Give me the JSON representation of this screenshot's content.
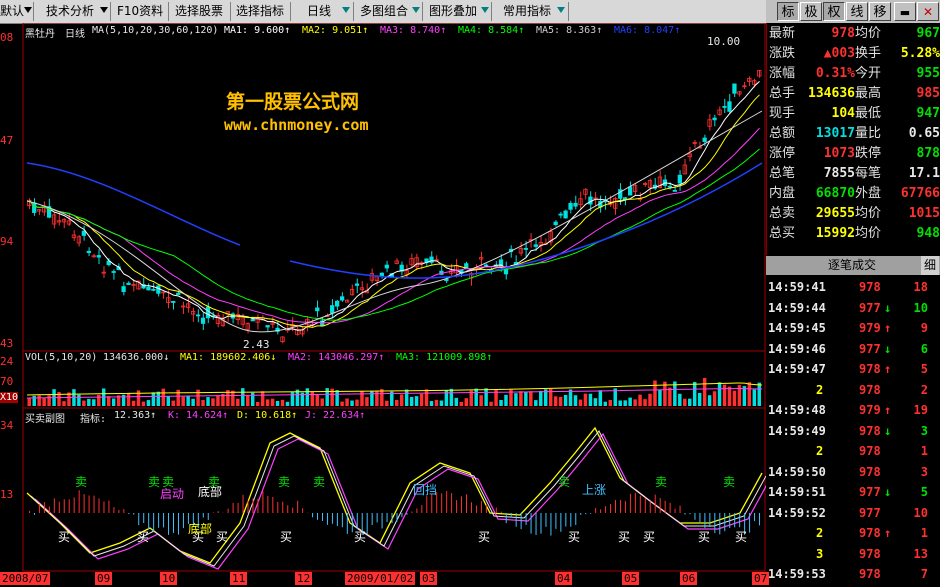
{
  "toolbar": {
    "items": [
      "默认",
      "技术分析",
      "F10资料",
      "选择股票",
      "选择指标",
      "日线",
      "多图组合",
      "图形叠加",
      "常用指标"
    ]
  },
  "right_tabs": [
    "标",
    "极",
    "权",
    "线",
    "移"
  ],
  "chart": {
    "stock_name": "黑牡丹",
    "period": "日线",
    "ma_header": "MA(5,10,20,30,60,120)",
    "ma": [
      {
        "label": "MA1:",
        "value": "9.600↑",
        "color": "#ffffff"
      },
      {
        "label": "MA2:",
        "value": "9.051↑",
        "color": "#ffff00"
      },
      {
        "label": "MA3:",
        "value": "8.740↑",
        "color": "#ff40ff"
      },
      {
        "label": "MA4:",
        "value": "8.584↑",
        "color": "#00ff00"
      },
      {
        "label": "MA5:",
        "value": "8.363↑",
        "color": "#cccccc"
      },
      {
        "label": "MA6:",
        "value": "8.047↑",
        "color": "#2040ff"
      }
    ],
    "watermark_title": "第一股票公式网",
    "watermark_url": "www.chnmoney.com",
    "high_label": "10.00",
    "low_label": "2.43",
    "y_labels": [
      "08",
      "47",
      "94",
      "43"
    ],
    "vol_header": "VOL(5,10,20)",
    "vol_value": "134636.000↓",
    "vol_ma": [
      {
        "label": "MA1:",
        "value": "189602.406↓",
        "color": "#ffff00"
      },
      {
        "label": "MA2:",
        "value": "143046.297↑",
        "color": "#ff40ff"
      },
      {
        "label": "MA3:",
        "value": "121009.898↑",
        "color": "#00ff00"
      }
    ],
    "vol_y_labels": [
      "24",
      "70",
      "X10"
    ],
    "ind_name": "买卖副图",
    "ind_label": "指标:",
    "ind_value": "12.363↑",
    "ind_k": "K: 14.624↑",
    "ind_d": "D: 10.618↑",
    "ind_j": "J: 22.634↑",
    "ind_y_labels": [
      "34",
      "13"
    ],
    "signals": {
      "sell": "卖",
      "buy": "买",
      "bottom": "底部",
      "launch": "启动",
      "pullback": "回挡",
      "up": "上涨"
    },
    "dates": [
      "2008/07",
      "09",
      "10",
      "11",
      "12",
      "2009/01/02",
      "03",
      "04",
      "05",
      "06",
      "07"
    ]
  },
  "quote": {
    "rows": [
      {
        "l1": "最新",
        "v1": "978",
        "c1": "#ff3030",
        "l2": "均价",
        "v2": "967",
        "c2": "#00e000"
      },
      {
        "l1": "涨跌",
        "v1": "▲003",
        "c1": "#ff3030",
        "l2": "换手",
        "v2": "5.28%",
        "c2": "#ffff00"
      },
      {
        "l1": "涨幅",
        "v1": "0.31%",
        "c1": "#ff3030",
        "l2": "今开",
        "v2": "955",
        "c2": "#00e000"
      },
      {
        "l1": "总手",
        "v1": "134636",
        "c1": "#ffff00",
        "l2": "最高",
        "v2": "985",
        "c2": "#ff3030"
      },
      {
        "l1": "现手",
        "v1": "104",
        "c1": "#ffff00",
        "l2": "最低",
        "v2": "947",
        "c2": "#00e000"
      },
      {
        "l1": "总额",
        "v1": "13017",
        "c1": "#00e0e0",
        "l2": "量比",
        "v2": "0.65",
        "c2": "#e8e8e8"
      },
      {
        "l1": "涨停",
        "v1": "1073",
        "c1": "#ff3030",
        "l2": "跌停",
        "v2": "878",
        "c2": "#00e000"
      },
      {
        "l1": "总笔",
        "v1": "7855",
        "c1": "#e8e8e8",
        "l2": "每笔",
        "v2": "17.1",
        "c2": "#e8e8e8"
      },
      {
        "l1": "内盘",
        "v1": "66870",
        "c1": "#00e000",
        "l2": "外盘",
        "v2": "67766",
        "c2": "#ff3030"
      },
      {
        "l1": "总卖",
        "v1": "29655",
        "c1": "#ffff00",
        "l2": "均价",
        "v2": "1015",
        "c2": "#ff3030"
      },
      {
        "l1": "总买",
        "v1": "15992",
        "c1": "#ffff00",
        "l2": "均价",
        "v2": "948",
        "c2": "#00e000"
      }
    ]
  },
  "ticks": {
    "title": "逐笔成交",
    "detail": "细",
    "rows": [
      {
        "time": "14:59:41",
        "price": "978",
        "pc": "#ff3030",
        "arrow": "",
        "vol": "18",
        "vc": "#ff3030"
      },
      {
        "time": "14:59:44",
        "price": "977",
        "pc": "#ff3030",
        "arrow": "down",
        "vol": "10",
        "vc": "#00e000"
      },
      {
        "time": "14:59:45",
        "price": "979",
        "pc": "#ff3030",
        "arrow": "up",
        "vol": "9",
        "vc": "#ff3030"
      },
      {
        "time": "14:59:46",
        "price": "977",
        "pc": "#ff3030",
        "arrow": "down",
        "vol": "6",
        "vc": "#00e000"
      },
      {
        "time": "14:59:47",
        "price": "978",
        "pc": "#ff3030",
        "arrow": "up",
        "vol": "5",
        "vc": "#ff3030"
      },
      {
        "time": "2",
        "price": "978",
        "pc": "#ff3030",
        "arrow": "",
        "vol": "2",
        "vc": "#ff3030"
      },
      {
        "time": "14:59:48",
        "price": "979",
        "pc": "#ff3030",
        "arrow": "up",
        "vol": "19",
        "vc": "#ff3030"
      },
      {
        "time": "14:59:49",
        "price": "978",
        "pc": "#ff3030",
        "arrow": "down",
        "vol": "3",
        "vc": "#00e000"
      },
      {
        "time": "2",
        "price": "978",
        "pc": "#ff3030",
        "arrow": "",
        "vol": "1",
        "vc": "#ff3030"
      },
      {
        "time": "14:59:50",
        "price": "978",
        "pc": "#ff3030",
        "arrow": "",
        "vol": "3",
        "vc": "#ff3030"
      },
      {
        "time": "14:59:51",
        "price": "977",
        "pc": "#ff3030",
        "arrow": "down",
        "vol": "5",
        "vc": "#00e000"
      },
      {
        "time": "14:59:52",
        "price": "977",
        "pc": "#ff3030",
        "arrow": "",
        "vol": "10",
        "vc": "#ff3030"
      },
      {
        "time": "2",
        "price": "978",
        "pc": "#ff3030",
        "arrow": "up",
        "vol": "1",
        "vc": "#ff3030"
      },
      {
        "time": "3",
        "price": "978",
        "pc": "#ff3030",
        "arrow": "",
        "vol": "13",
        "vc": "#ff3030"
      },
      {
        "time": "14:59:53",
        "price": "978",
        "pc": "#ff3030",
        "arrow": "",
        "vol": "7",
        "vc": "#ff3030"
      }
    ]
  }
}
